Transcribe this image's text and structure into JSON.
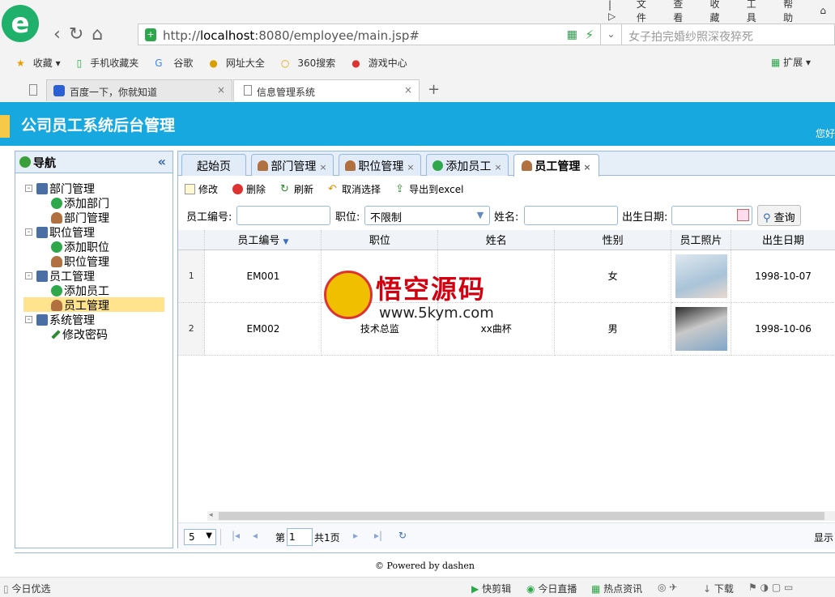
{
  "browser": {
    "menu": [
      "文件",
      "查看",
      "收藏",
      "工具",
      "帮助"
    ],
    "url_prefix": "http://",
    "url_host": "localhost",
    "url_rest": ":8080/employee/main.jsp#",
    "search_placeholder": "女子拍完婚纱照深夜猝死",
    "bookmarks": [
      "收藏",
      "手机收藏夹",
      "谷歌",
      "网址大全",
      "360搜索",
      "游戏中心"
    ],
    "bookmark_right": "扩展",
    "tabs": [
      {
        "label": "百度一下，你就知道"
      },
      {
        "label": "信息管理系统"
      }
    ]
  },
  "app": {
    "title": "公司员工系统后台管理",
    "greeting": "您好",
    "nav_title": "导航",
    "tree": [
      {
        "label": "部门管理"
      },
      {
        "label": "添加部门"
      },
      {
        "label": "部门管理"
      },
      {
        "label": "职位管理"
      },
      {
        "label": "添加职位"
      },
      {
        "label": "职位管理"
      },
      {
        "label": "员工管理"
      },
      {
        "label": "添加员工"
      },
      {
        "label": "员工管理"
      },
      {
        "label": "系统管理"
      },
      {
        "label": "修改密码"
      }
    ],
    "tabs": [
      {
        "label": "起始页"
      },
      {
        "label": "部门管理"
      },
      {
        "label": "职位管理"
      },
      {
        "label": "添加员工"
      },
      {
        "label": "员工管理"
      }
    ],
    "tab_close": "×",
    "toolbar": [
      "修改",
      "删除",
      "刷新",
      "取消选择",
      "导出到excel"
    ],
    "filters": {
      "emp_no_label": "员工编号:",
      "position_label": "职位:",
      "position_value": "不限制",
      "name_label": "姓名:",
      "birth_label": "出生日期:",
      "query_label": "查询"
    },
    "columns": [
      "员工编号",
      "职位",
      "姓名",
      "性别",
      "员工照片",
      "出生日期"
    ],
    "rows": [
      {
        "n": "1",
        "emp_no": "EM001",
        "position": "",
        "name": "",
        "gender": "女",
        "birth": "1998-10-07"
      },
      {
        "n": "2",
        "emp_no": "EM002",
        "position": "技术总监",
        "name": "xx曲杯",
        "gender": "男",
        "birth": "1998-10-06"
      }
    ],
    "pager": {
      "page_size": "5",
      "page_prefix": "第",
      "page_value": "1",
      "page_suffix": "共1页",
      "display": "显示"
    },
    "footer": "© Powered by dashen",
    "watermark_text": "悟空源码",
    "watermark_url": "www.5kym.com"
  },
  "statusbar": {
    "left": "今日优选",
    "right": [
      "快剪辑",
      "今日直播",
      "热点资讯",
      "下载"
    ]
  }
}
